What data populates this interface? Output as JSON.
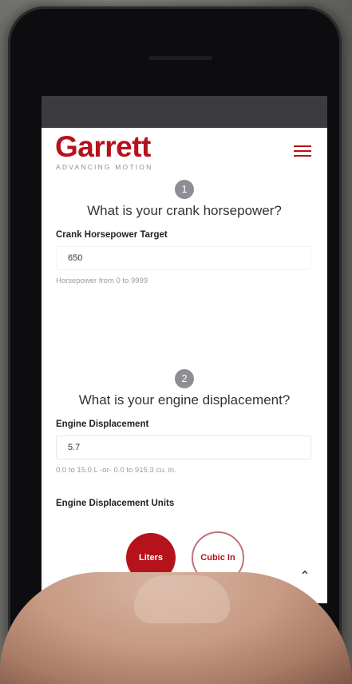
{
  "brand": {
    "name": "Garrett",
    "tagline": "ADVANCING MOTION",
    "color": "#b5121b"
  },
  "header": {
    "menu_icon": "hamburger-menu-icon"
  },
  "step1": {
    "number": "1",
    "question": "What is your crank horsepower?",
    "label": "Crank Horsepower Target",
    "value": "650",
    "hint": "Horsepower from 0 to 9999"
  },
  "step2": {
    "number": "2",
    "question": "What is your engine displacement?",
    "label": "Engine Displacement",
    "value": "5.7",
    "hint": "0.0 to 15.0 L -or- 0.0 to 915.3 cu. in.",
    "units_label": "Engine Displacement Units",
    "units": {
      "selected": "Liters",
      "other": "Cubic In"
    }
  },
  "scroll_top_icon": "chevron-up-icon"
}
